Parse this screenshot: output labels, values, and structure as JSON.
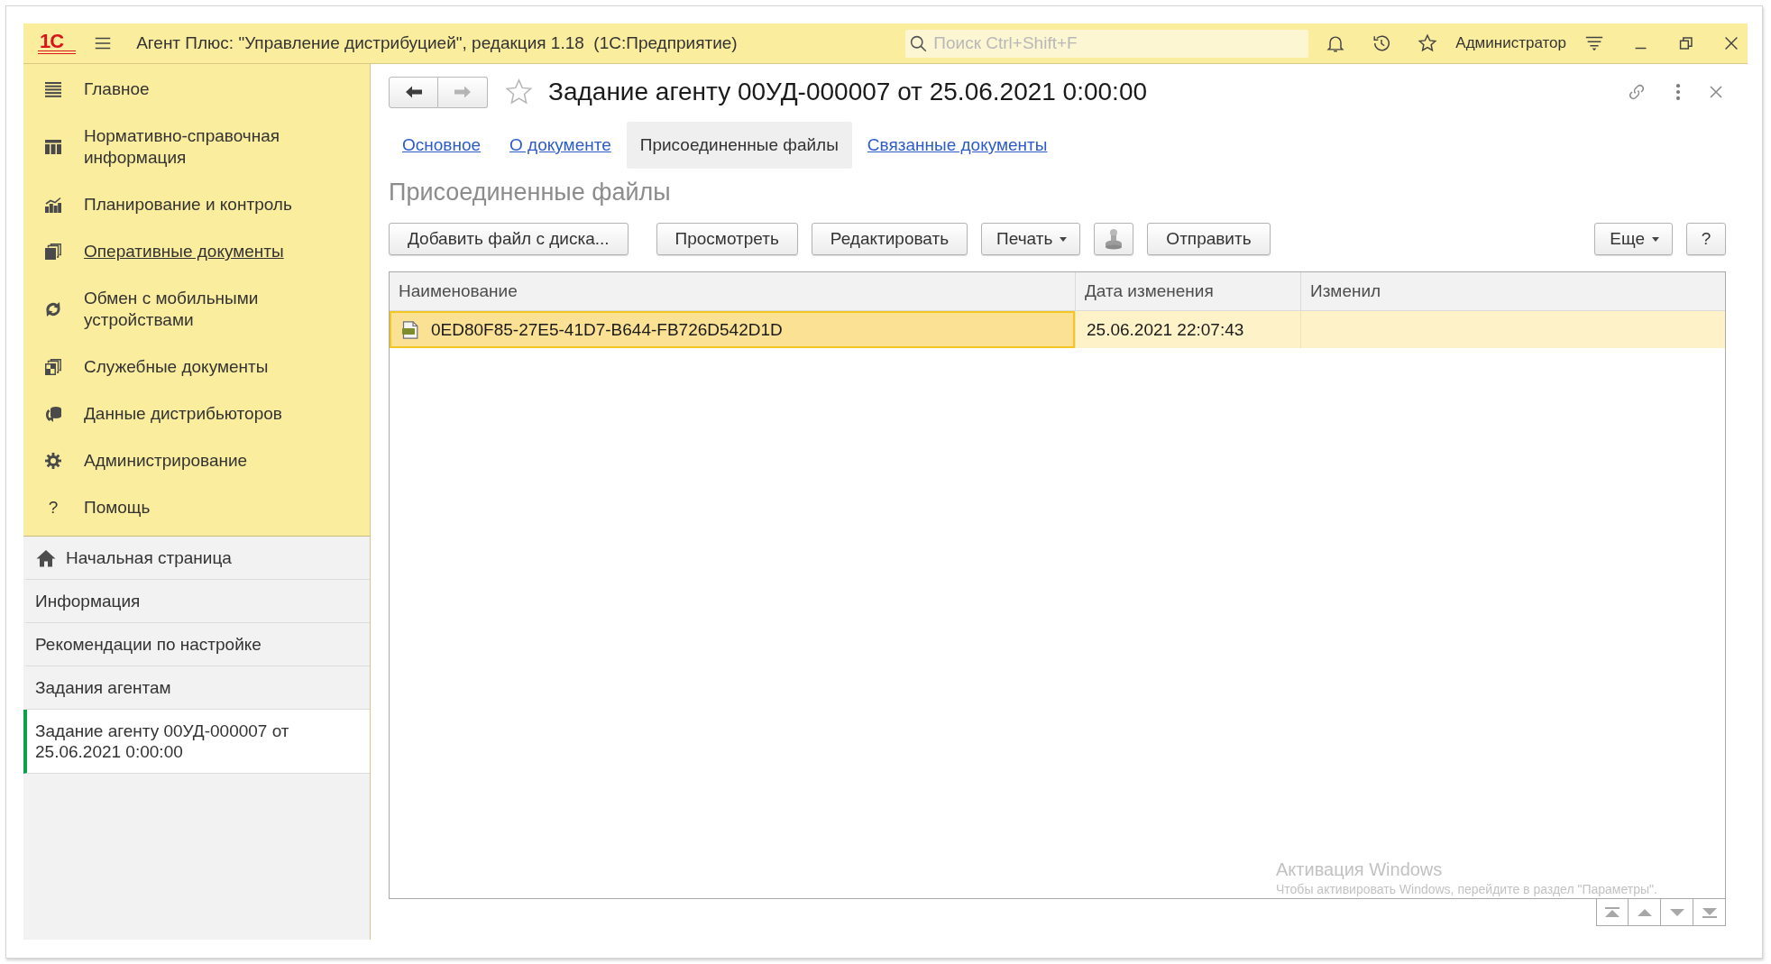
{
  "window": {
    "logo": "1С",
    "title": "Агент Плюс: \"Управление дистрибуцией\", редакция 1.18  (1С:Предприятие)",
    "search": {
      "placeholder": "Поиск Ctrl+Shift+F"
    },
    "user": "Администратор"
  },
  "sidebar": {
    "sections": [
      {
        "label": "Главное",
        "hovered": false
      },
      {
        "label": "Нормативно-справочная информация",
        "hovered": false
      },
      {
        "label": "Планирование и контроль",
        "hovered": false
      },
      {
        "label": "Оперативные документы",
        "hovered": true
      },
      {
        "label": "Обмен с мобильными устройствами",
        "hovered": false
      },
      {
        "label": "Служебные документы",
        "hovered": false
      },
      {
        "label": "Данные дистрибьюторов",
        "hovered": false
      },
      {
        "label": "Администрирование",
        "hovered": false
      },
      {
        "label": "Помощь",
        "hovered": false,
        "glyph": "?"
      }
    ],
    "open_pages": [
      {
        "kind": "home",
        "label": "Начальная страница",
        "selected": false
      },
      {
        "kind": "page",
        "label": "Информация",
        "selected": false
      },
      {
        "kind": "page",
        "label": "Рекомендации по настройке",
        "selected": false
      },
      {
        "kind": "page",
        "label": "Задания агентам",
        "selected": false
      },
      {
        "kind": "page",
        "label": "Задание агенту 00УД-000007 от 25.06.2021 0:00:00",
        "selected": true
      }
    ]
  },
  "document": {
    "navigation": [
      {
        "kind": "back",
        "disabled": false
      },
      {
        "kind": "forward",
        "disabled": true
      }
    ],
    "favorite": false,
    "title": "Задание агенту 00УД-000007 от 25.06.2021 0:00:00",
    "tabs": [
      {
        "label": "Основное",
        "selected": false
      },
      {
        "label": "О документе",
        "selected": false
      },
      {
        "label": "Присоединенные файлы",
        "selected": true
      },
      {
        "label": "Связанные документы",
        "selected": false
      }
    ],
    "section_title": "Присоединенные файлы",
    "toolbar": {
      "groups": [
        {
          "buttons": [
            {
              "kind": "button",
              "label": "Добавить файл с диска..."
            }
          ]
        },
        {
          "buttons": [
            {
              "kind": "button",
              "label": "Просмотреть"
            },
            {
              "kind": "button",
              "label": "Редактировать"
            },
            {
              "kind": "dropdown",
              "label": "Печать"
            },
            {
              "kind": "icon"
            },
            {
              "kind": "button",
              "label": "Отправить"
            }
          ]
        }
      ],
      "right": [
        {
          "kind": "dropdown",
          "label": "Еще"
        },
        {
          "kind": "button",
          "label": "?"
        }
      ]
    },
    "table": {
      "columns": [
        "Наименование",
        "Дата изменения",
        "Изменил"
      ],
      "rows": [
        {
          "selected": true,
          "cells": [
            {
              "text": "0ED80F85-27E5-41D7-B644-FB726D542D1D",
              "focused": true
            },
            {
              "text": "25.06.2021 22:07:43",
              "focused": false
            }
          ]
        }
      ]
    }
  },
  "windows_activation": {
    "title": "Активация Windows",
    "message": "Чтобы активировать Windows, перейдите в раздел \"Параметры\"."
  }
}
